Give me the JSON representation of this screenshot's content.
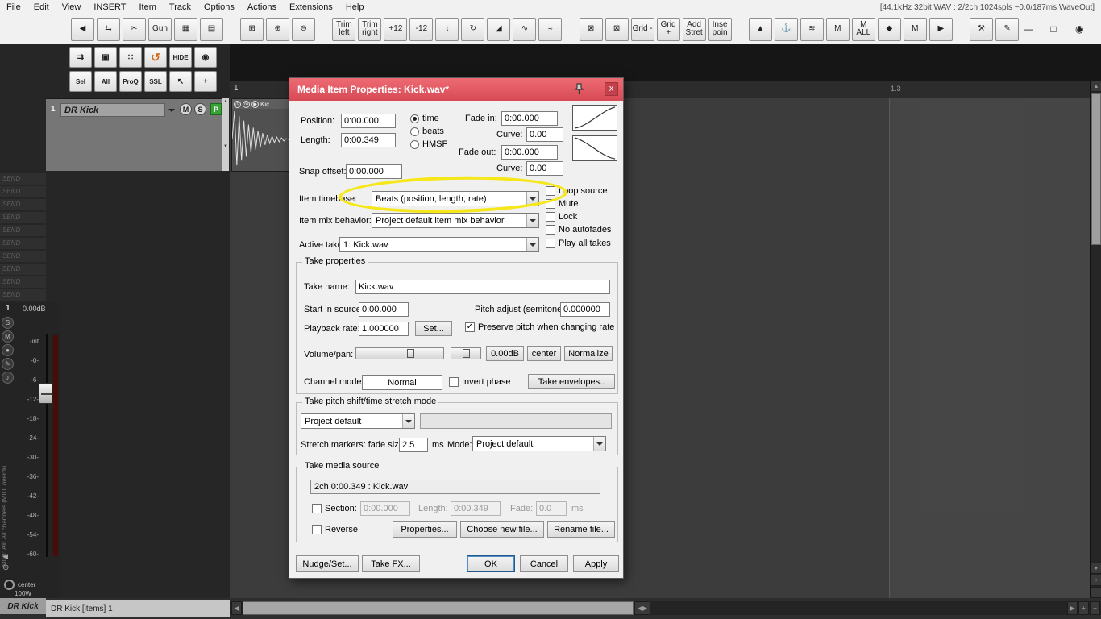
{
  "colors": {
    "titlebar_red": "#e1565e",
    "highlight_yellow": "#f5e718",
    "undo_orange": "#d2691e",
    "badge_green": "#3aa03a"
  },
  "menu": {
    "items": [
      "File",
      "Edit",
      "View",
      "INSERT",
      "Item",
      "Track",
      "Options",
      "Actions",
      "Extensions",
      "Help"
    ],
    "right_status": "[44.1kHz 32bit WAV : 2/2ch 1024spls ~0.0/187ms WaveOut]"
  },
  "toolbar": {
    "groups": [
      {
        "buttons": [
          {
            "name": "nav-back",
            "text": "◀"
          },
          {
            "name": "swap",
            "text": "⇆"
          },
          {
            "name": "scissors",
            "text": "✂"
          },
          {
            "name": "gun",
            "text": "Gun"
          },
          {
            "name": "edit-box-1",
            "text": "▦"
          },
          {
            "name": "edit-box-2",
            "text": "▤"
          }
        ]
      },
      {
        "buttons": [
          {
            "name": "zoom-frame",
            "text": "⊞"
          },
          {
            "name": "zoom-in",
            "text": "⊕"
          },
          {
            "name": "zoom-out",
            "text": "⊖"
          }
        ]
      },
      {
        "buttons": [
          {
            "name": "trim-left",
            "text": "Trim left"
          },
          {
            "name": "trim-right",
            "text": "Trim right"
          },
          {
            "name": "plus-12",
            "text": "+12"
          },
          {
            "name": "minus-12",
            "text": "-12"
          },
          {
            "name": "item-fades",
            "text": "↕"
          },
          {
            "name": "loop",
            "text": "↻"
          },
          {
            "name": "fade-shape",
            "text": "◢"
          },
          {
            "name": "envelope-1",
            "text": "∿"
          },
          {
            "name": "envelope-2",
            "text": "≈"
          }
        ]
      },
      {
        "buttons": [
          {
            "name": "clear-1",
            "text": "⊠"
          },
          {
            "name": "clear-2",
            "text": "⊠"
          },
          {
            "name": "grid-minus",
            "text": "Grid -"
          },
          {
            "name": "grid-plus",
            "text": "Grid +"
          },
          {
            "name": "add-stretch",
            "text": "Add Stret"
          },
          {
            "name": "insert-point",
            "text": "Inse poin"
          }
        ]
      },
      {
        "buttons": [
          {
            "name": "arm",
            "text": "▲"
          },
          {
            "name": "anchor",
            "text": "⚓"
          },
          {
            "name": "env-display",
            "text": "≋"
          },
          {
            "name": "monitor-m",
            "text": "M"
          },
          {
            "name": "m-all",
            "text": "M ALL"
          },
          {
            "name": "metronome",
            "text": "◆"
          },
          {
            "name": "master-m",
            "text": "M"
          },
          {
            "name": "play",
            "text": "▶"
          }
        ]
      },
      {
        "buttons": [
          {
            "name": "wrench",
            "text": "⚒"
          },
          {
            "name": "stamp",
            "text": "✎"
          }
        ]
      }
    ],
    "window": [
      {
        "name": "minimize",
        "text": "—"
      },
      {
        "name": "maximize",
        "text": "□"
      },
      {
        "name": "power",
        "text": "◉"
      }
    ]
  },
  "left_toolbar": {
    "row1": [
      {
        "name": "routing",
        "text": "⇉"
      },
      {
        "name": "save",
        "text": "▣"
      },
      {
        "name": "grid-dots",
        "text": "∷"
      },
      {
        "name": "undo",
        "text": "↺"
      },
      {
        "name": "hide",
        "text": "HIDE"
      },
      {
        "name": "eye",
        "text": "◉"
      }
    ],
    "row2": [
      {
        "name": "sel",
        "text": "Sel"
      },
      {
        "name": "all",
        "text": "All"
      },
      {
        "name": "proq",
        "text": "ProQ"
      },
      {
        "name": "ssl",
        "text": "SSL"
      },
      {
        "name": "cursor",
        "text": "↖"
      },
      {
        "name": "add",
        "text": "+"
      }
    ]
  },
  "track": {
    "number": "1",
    "name": "DR Kick",
    "mute": "M",
    "solo": "S",
    "badge": "P"
  },
  "sends": [
    "SEND",
    "SEND",
    "SEND",
    "SEND",
    "SEND",
    "SEND",
    "SEND",
    "SEND",
    "SEND",
    "SEND"
  ],
  "mixer": {
    "number": "1",
    "gain": "0.00dB",
    "buttons": [
      {
        "name": "solo",
        "text": "S"
      },
      {
        "name": "mute",
        "text": "M"
      },
      {
        "name": "recarm",
        "text": "●"
      },
      {
        "name": "env",
        "text": "✎"
      },
      {
        "name": "fx",
        "text": "♪"
      }
    ],
    "scale": [
      "-inf",
      "-0-",
      "-6-",
      "-12-",
      "-18-",
      "-24-",
      "-30-",
      "-36-",
      "-42-",
      "-48-",
      "-54-",
      "-60-"
    ],
    "speaker": "◀",
    "mono": "⊖",
    "pan": "center",
    "width": "100W",
    "vertical_label": "MIDI: All: All channels (MIDI overdu"
  },
  "arrange": {
    "ruler_first": "1",
    "ruler_mark": "1.3",
    "item": {
      "icons": [
        "◷",
        "M",
        "▶"
      ],
      "label": "Kic"
    }
  },
  "dialog": {
    "title": "Media Item Properties:  Kick.wav*",
    "close": "x",
    "position_label": "Position:",
    "position_value": "0:00.000",
    "length_label": "Length:",
    "length_value": "0:00.349",
    "radio_time": "time",
    "radio_beats": "beats",
    "radio_hmsf": "HMSF",
    "fade_in_label": "Fade in:",
    "fade_in_value": "0:00.000",
    "curve_label": "Curve:",
    "fade_in_curve": "0.00",
    "fade_out_label": "Fade out:",
    "fade_out_value": "0:00.000",
    "fade_out_curve": "0.00",
    "snap_offset_label": "Snap offset:",
    "snap_offset_value": "0:00.000",
    "item_timebase_label": "Item timebase:",
    "item_timebase_value": "Beats (position, length, rate)",
    "item_mix_label": "Item mix behavior:",
    "item_mix_value": "Project default item mix behavior",
    "active_take_label": "Active take:",
    "active_take_value": "1: Kick.wav",
    "checks": {
      "loop_source": "Loop source",
      "mute": "Mute",
      "lock": "Lock",
      "no_autofades": "No autofades",
      "play_all_takes": "Play all takes"
    },
    "take_props": {
      "group_title": "Take properties",
      "take_name_label": "Take name:",
      "take_name_value": "Kick.wav",
      "start_label": "Start in source:",
      "start_value": "0:00.000",
      "pitch_label": "Pitch adjust (semitones):",
      "pitch_value": "0.000000",
      "rate_label": "Playback rate:",
      "rate_value": "1.000000",
      "set_button": "Set...",
      "preserve_pitch": "Preserve pitch when changing rate",
      "volpan_label": "Volume/pan:",
      "vol_button": "0.00dB",
      "pan_button": "center",
      "normalize_button": "Normalize",
      "chanmode_label": "Channel mode:",
      "chanmode_value": "Normal",
      "invert_phase": "Invert phase",
      "take_env_button": "Take envelopes.."
    },
    "pitch_group": {
      "group_title": "Take pitch shift/time stretch mode",
      "mode_value": "Project default",
      "stretch_label": "Stretch markers: fade size:",
      "stretch_value": "2.5",
      "ms_label": "ms",
      "mode_label": "Mode:",
      "mode2_value": "Project default"
    },
    "source_group": {
      "group_title": "Take media source",
      "source_info": "2ch 0:00.349 : Kick.wav",
      "section_label": "Section:",
      "section_value": "0:00.000",
      "length_label": "Length:",
      "length_value": "0:00.349",
      "fade_label": "Fade:",
      "fade_value": "0.0",
      "ms_label": "ms",
      "reverse_label": "Reverse",
      "properties_button": "Properties...",
      "choose_button": "Choose new file...",
      "rename_button": "Rename file..."
    },
    "buttons": {
      "nudge": "Nudge/Set...",
      "takefx": "Take FX...",
      "ok": "OK",
      "cancel": "Cancel",
      "apply": "Apply"
    }
  },
  "annotation": {
    "shape": "ellipse",
    "color": "#f5e718"
  },
  "statusbar": {
    "mcp_label": "DR Kick",
    "info": "DR Kick [items] 1"
  },
  "scroll": {
    "left": "◀",
    "right": "▶",
    "up": "▲",
    "down": "▼",
    "plus": "+",
    "minus": "−",
    "grip": "◀▶"
  }
}
